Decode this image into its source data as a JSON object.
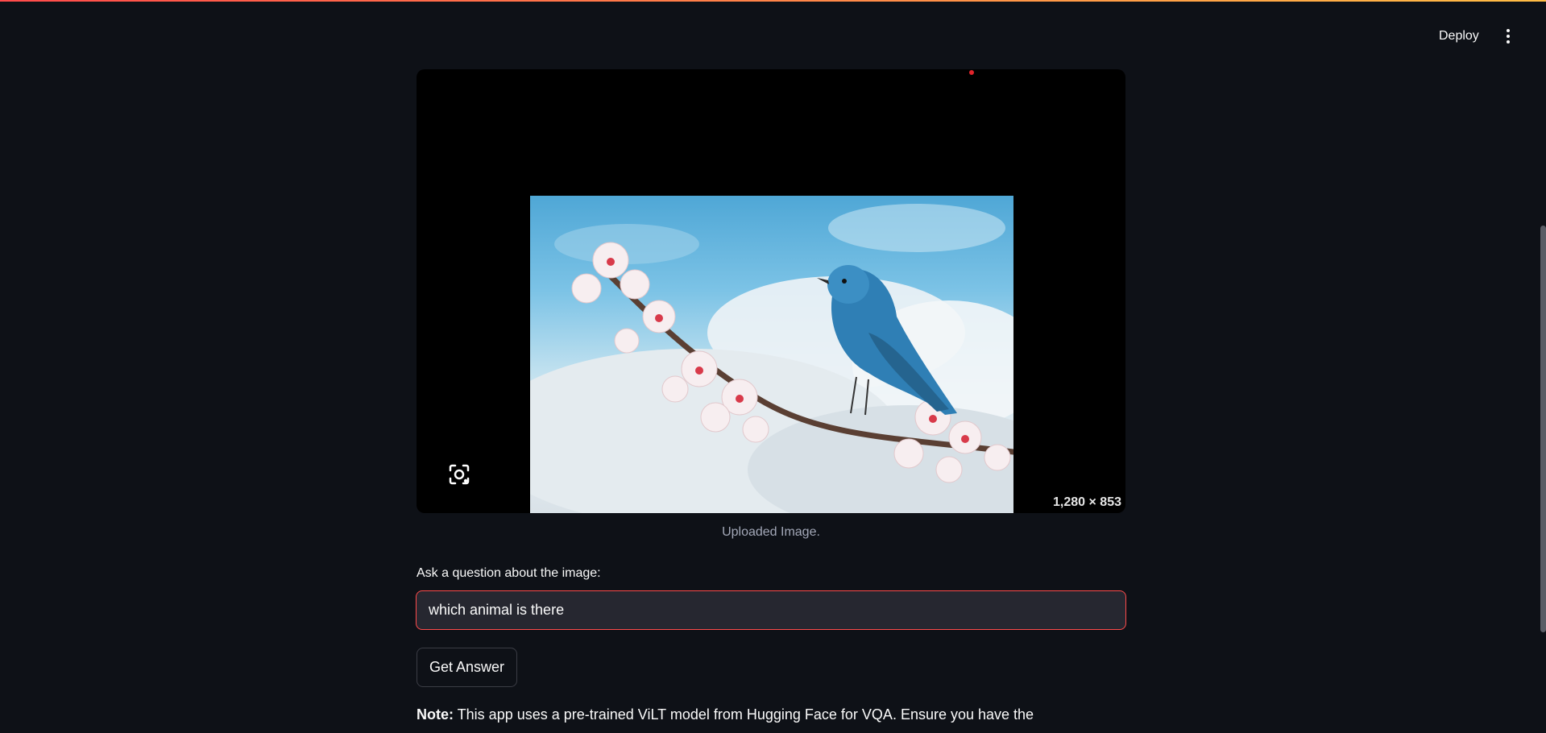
{
  "header": {
    "deploy_label": "Deploy",
    "menu_icon": "vertical-dots-icon"
  },
  "image": {
    "dimensions_label": "1,280 × 853",
    "lens_icon": "google-lens-icon",
    "caption": "Uploaded Image."
  },
  "question": {
    "label": "Ask a question about the image:",
    "value": "which animal is there"
  },
  "actions": {
    "get_answer_label": "Get Answer"
  },
  "note": {
    "prefix": "Note:",
    "text": " This app uses a pre-trained ViLT model from Hugging Face for VQA. Ensure you have the"
  },
  "colors": {
    "background": "#0e1117",
    "accent": "#ff4b4b",
    "input_bg": "#262730"
  }
}
